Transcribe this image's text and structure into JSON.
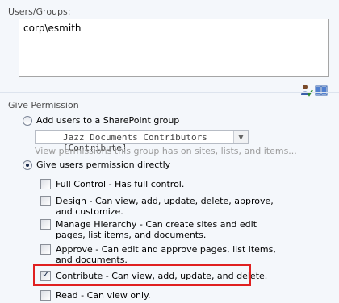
{
  "users_groups": {
    "label": "Users/Groups:",
    "value": "corp\\esmith",
    "icons": [
      "check-names-icon",
      "browse-address-book-icon"
    ]
  },
  "give_permission": {
    "label": "Give Permission",
    "add_to_group": {
      "label": "Add users to a SharePoint group",
      "selected": false,
      "group_select_value": "Jazz Documents Contributors [Contribute]",
      "hint": "View permissions this group has on sites, lists, and items..."
    },
    "direct": {
      "label": "Give users permission directly",
      "selected": true
    },
    "permissions": [
      {
        "text": "Full Control - Has full control.",
        "checked": false
      },
      {
        "text": "Design - Can view, add, update, delete, approve, and customize.",
        "checked": false
      },
      {
        "text": "Manage Hierarchy - Can create sites and edit pages, list items, and documents.",
        "checked": false
      },
      {
        "text": "Approve - Can edit and approve pages, list items, and documents.",
        "checked": false
      },
      {
        "text": "Contribute - Can view, add, update, and delete.",
        "checked": true
      },
      {
        "text": "Read - Can view only.",
        "checked": false
      }
    ]
  },
  "colors": {
    "highlight": "#e02020",
    "background": "#f4f7fb"
  }
}
